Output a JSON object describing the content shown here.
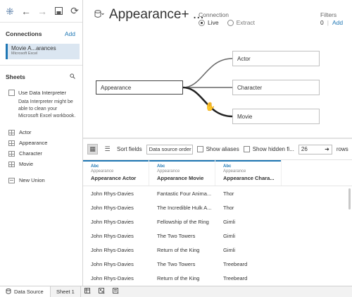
{
  "toolbar": {
    "icons": [
      "tableau-logo-icon",
      "back-icon",
      "forward-icon",
      "save-icon",
      "refresh-icon"
    ]
  },
  "connections": {
    "title": "Connections",
    "add_label": "Add",
    "items": [
      {
        "name": "Movie A...arances",
        "type": "Microsoft Excel"
      }
    ]
  },
  "sheets": {
    "title": "Sheets",
    "interpreter_label": "Use Data Interpreter",
    "interpreter_note": "Data Interpreter might be able to clean your Microsoft Excel workbook.",
    "items": [
      {
        "label": "Actor"
      },
      {
        "label": "Appearance"
      },
      {
        "label": "Character"
      },
      {
        "label": "Movie"
      }
    ],
    "new_union": "New Union"
  },
  "header": {
    "title": "Appearance+ ...",
    "connection_label": "Connection",
    "live_label": "Live",
    "extract_label": "Extract",
    "filters_label": "Filters",
    "filters_count": "0",
    "filters_add": "Add"
  },
  "canvas": {
    "main_table": "Appearance",
    "joined_tables": [
      "Actor",
      "Character",
      "Movie"
    ]
  },
  "grid_toolbar": {
    "sort_label": "Sort fields",
    "sort_value": "Data source order",
    "show_aliases": "Show aliases",
    "show_hidden": "Show hidden fi...",
    "rows_value": "26",
    "rows_label": "rows"
  },
  "grid": {
    "columns": [
      {
        "type": "Abc",
        "source": "Appearance",
        "name": "Appearance Actor"
      },
      {
        "type": "Abc",
        "source": "Appearance",
        "name": "Appearance Movie"
      },
      {
        "type": "Abc",
        "source": "Appearance",
        "name": "Appearance Chara..."
      }
    ],
    "rows": [
      [
        "John Rhys-Davies",
        "Fantastic Four Anima...",
        "Thor"
      ],
      [
        "John Rhys-Davies",
        "The Incredible Hulk A...",
        "Thor"
      ],
      [
        "John Rhys-Davies",
        "Fellowship of the Ring",
        "Gimli"
      ],
      [
        "John Rhys-Davies",
        "The Two Towers",
        "Gimli"
      ],
      [
        "John Rhys-Davies",
        "Return of the King",
        "Gimli"
      ],
      [
        "John Rhys-Davies",
        "The Two Towers",
        "Treebeard"
      ],
      [
        "John Rhys-Davies",
        "Return of the King",
        "Treebeard"
      ]
    ]
  },
  "tabs": {
    "data_source": "Data Source",
    "sheet1": "Sheet 1"
  },
  "colors": {
    "accent": "#1f77b4",
    "selection": "#dbe6f1"
  }
}
